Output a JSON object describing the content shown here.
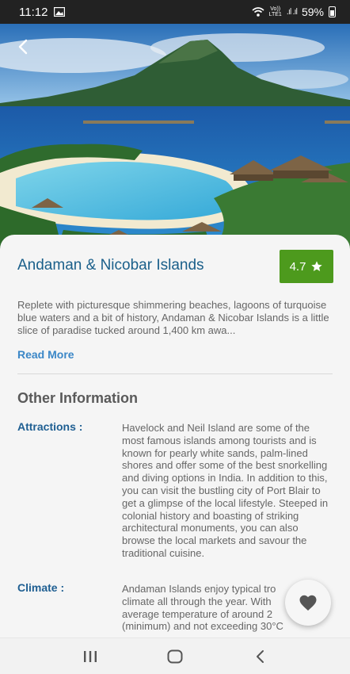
{
  "status_bar": {
    "time": "11:12",
    "network_top": "Vo))",
    "network_bottom": "LTE1",
    "signal_icons": ".ıl .ıl",
    "battery_percent": "59%"
  },
  "header": {
    "back_icon": "back-arrow-icon",
    "image": "tropical-island-lagoon-photo"
  },
  "place": {
    "title": "Andaman & Nicobar Islands",
    "rating": "4.7",
    "rating_icon": "star-icon",
    "rating_color": "#4d9a1d",
    "description": "Replete with picturesque shimmering beaches, lagoons of turquoise blue waters and a bit of history, Andaman & Nicobar Islands is a little slice of paradise tucked around 1,400 km awa...",
    "read_more": "Read More"
  },
  "other_information": {
    "heading": "Other Information",
    "items": [
      {
        "label": "Attractions :",
        "text": "Havelock and Neil Island are some of the most famous islands among tourists and is known for pearly white sands, palm-lined shores and offer some of the best snorkelling and diving options in India. In addition to this, you can visit the bustling city of Port Blair to get a glimpse of the local lifestyle. Steeped in colonial history and boasting of striking architectural monuments, you can also browse the local markets and savour the traditional cuisine."
      },
      {
        "label": "Climate :",
        "text": "Andaman Islands enjoy typical tro climate all through the year. With average temperature of around 2 (minimum) and not exceeding 30°C"
      }
    ]
  },
  "favorite_button": {
    "icon": "heart-icon"
  },
  "nav_bar": {
    "recents_icon": "recents-icon",
    "home_icon": "home-icon",
    "back_icon": "nav-back-icon"
  },
  "colors": {
    "title": "#1a5f8a",
    "label": "#1f5f92",
    "link": "#3b87c7"
  }
}
